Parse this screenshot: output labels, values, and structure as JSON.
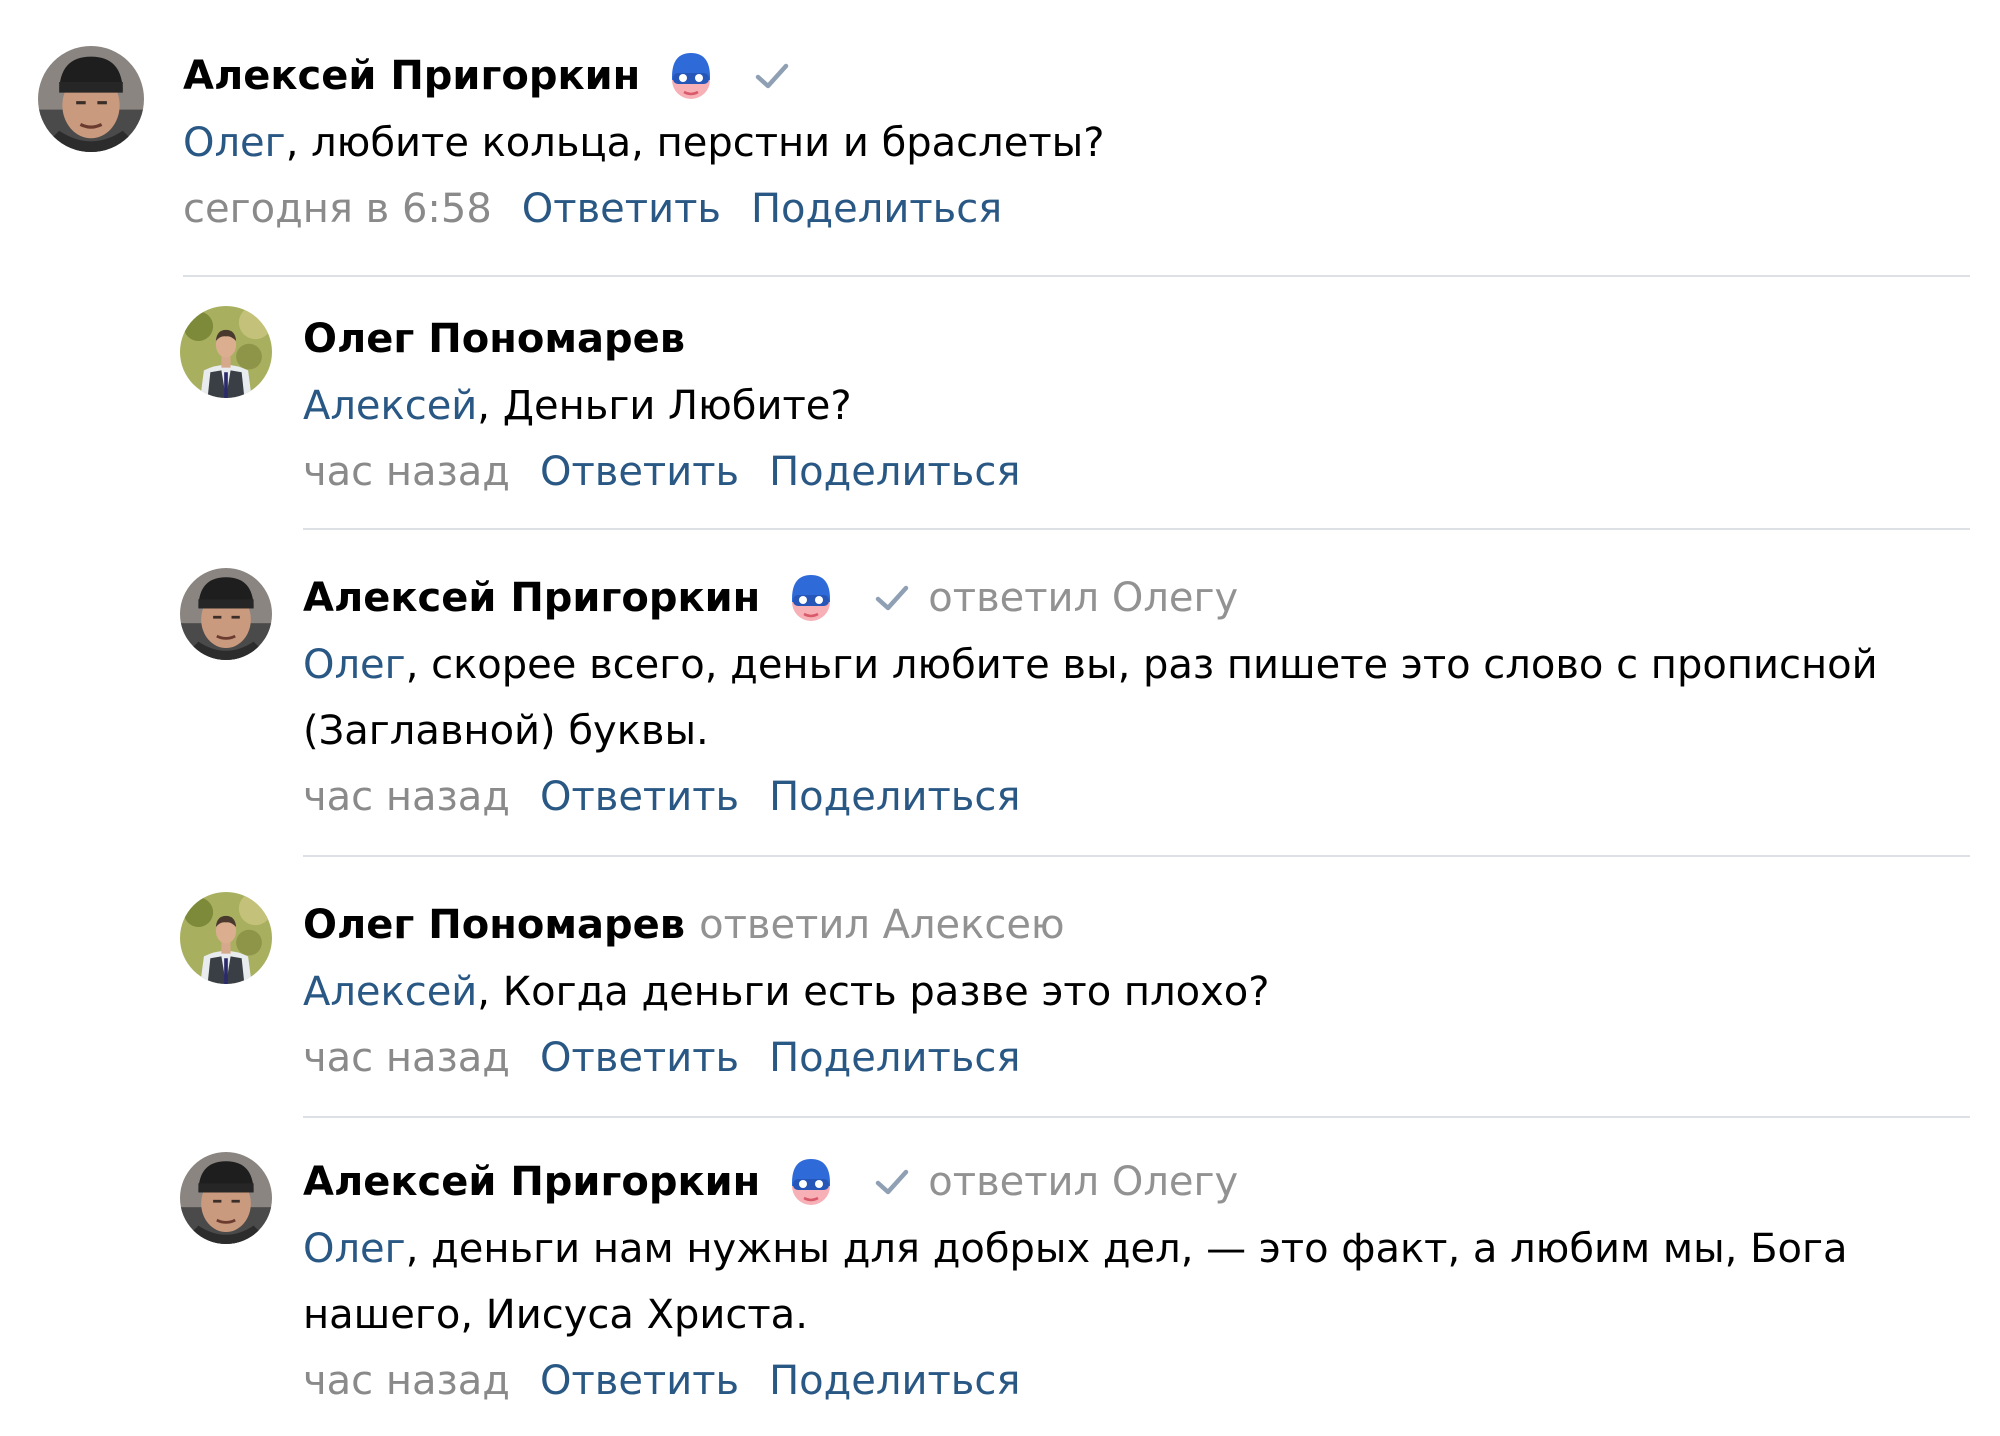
{
  "comments": [
    {
      "author": "Алексей Пригоркин",
      "avatar_icon": "avatar-man-beanie-icon",
      "badge_icon": "superhero-mask-badge-icon",
      "verified_icon": "check-icon",
      "replied_to": "",
      "mention": "Олег",
      "text": ", любите кольца, перстни и браслеты?",
      "date": "сегодня в 6:58",
      "reply_label": "Ответить",
      "share_label": "Поделиться"
    },
    {
      "author": "Олег Пономарев",
      "avatar_icon": "avatar-man-suit-icon",
      "replied_to": "",
      "mention": "Алексей",
      "text": ", Деньги Любите?",
      "date": "час назад",
      "reply_label": "Ответить",
      "share_label": "Поделиться"
    },
    {
      "author": "Алексей Пригоркин",
      "avatar_icon": "avatar-man-beanie-icon",
      "badge_icon": "superhero-mask-badge-icon",
      "verified_icon": "check-icon",
      "replied_to": "ответил Олегу",
      "mention": "Олег",
      "text": ", скорее всего, деньги любите вы, раз пишете это слово с прописной (Заглавной) буквы.",
      "date": "час назад",
      "reply_label": "Ответить",
      "share_label": "Поделиться"
    },
    {
      "author": "Олег Пономарев",
      "avatar_icon": "avatar-man-suit-icon",
      "replied_to": "ответил Алексею",
      "mention": "Алексей",
      "text": ", Когда деньги есть разве это плохо?",
      "date": "час назад",
      "reply_label": "Ответить",
      "share_label": "Поделиться"
    },
    {
      "author": "Алексей Пригоркин",
      "avatar_icon": "avatar-man-beanie-icon",
      "badge_icon": "superhero-mask-badge-icon",
      "verified_icon": "check-icon",
      "replied_to": "ответил Олегу",
      "mention": "Олег",
      "text": ", деньги нам нужны для добрых дел, — это факт, а любим мы, Бога нашего, Иисуса Христа.",
      "date": "час назад",
      "reply_label": "Ответить",
      "share_label": "Поделиться"
    }
  ],
  "colors": {
    "link": "#2a5885",
    "meta_gray": "#8a8a8a",
    "divider": "#dde1e6"
  }
}
